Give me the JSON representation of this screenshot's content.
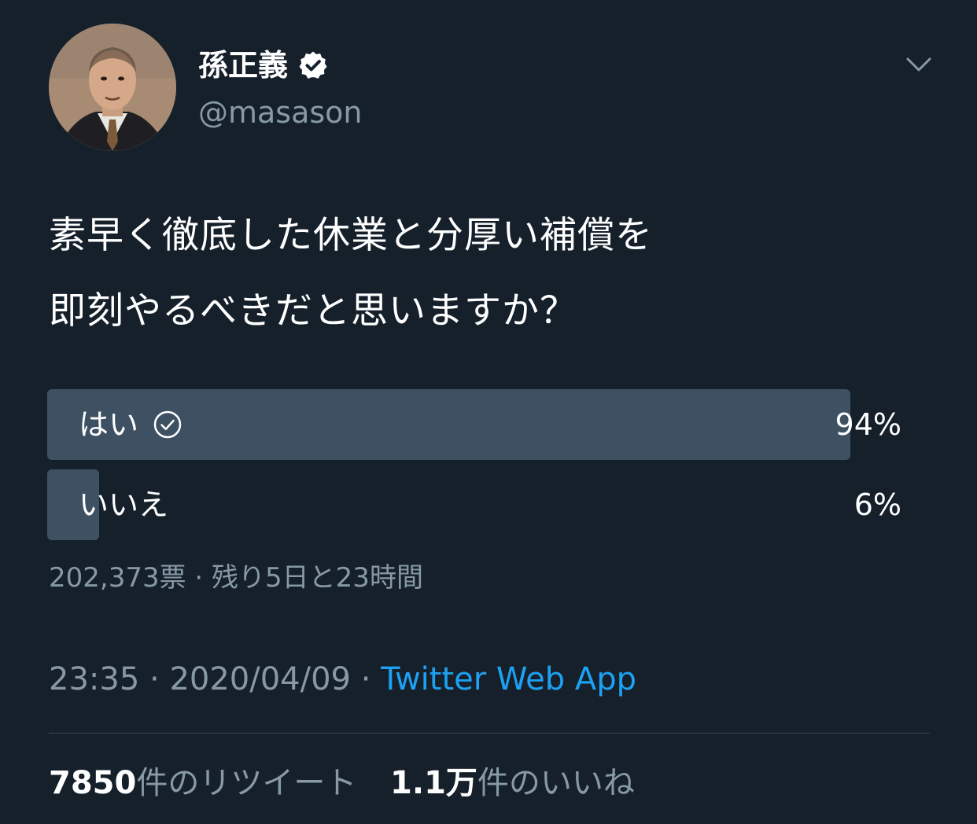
{
  "author": {
    "display_name": "孫正義",
    "handle": "@masason",
    "verified": true
  },
  "tweet": {
    "text_lines": [
      "素早く徹底した休業と分厚い補償を",
      "即刻やるべきだと思いますか？"
    ]
  },
  "poll": {
    "options": [
      {
        "label": "はい",
        "percent_label": "94%",
        "percent": 94,
        "selected": true
      },
      {
        "label": "いいえ",
        "percent_label": "6%",
        "percent": 6,
        "selected": false
      }
    ],
    "votes": "202,373票",
    "separator": "·",
    "remaining": "残り5日と23時間"
  },
  "meta": {
    "time": "23:35",
    "date": "2020/04/09",
    "separator": "·",
    "source": "Twitter Web App"
  },
  "stats": {
    "retweets_num": "7850",
    "retweets_label": "件のリツイート",
    "likes_num": "1.1万",
    "likes_label": "件のいいね"
  },
  "colors": {
    "background": "#15202b",
    "poll_bar": "#3e5163",
    "secondary_text": "#8899a6",
    "link": "#1da1f2"
  },
  "icons": {
    "verified": "verified-badge-icon",
    "menu": "chevron-down-icon",
    "selected": "check-circle-icon"
  }
}
